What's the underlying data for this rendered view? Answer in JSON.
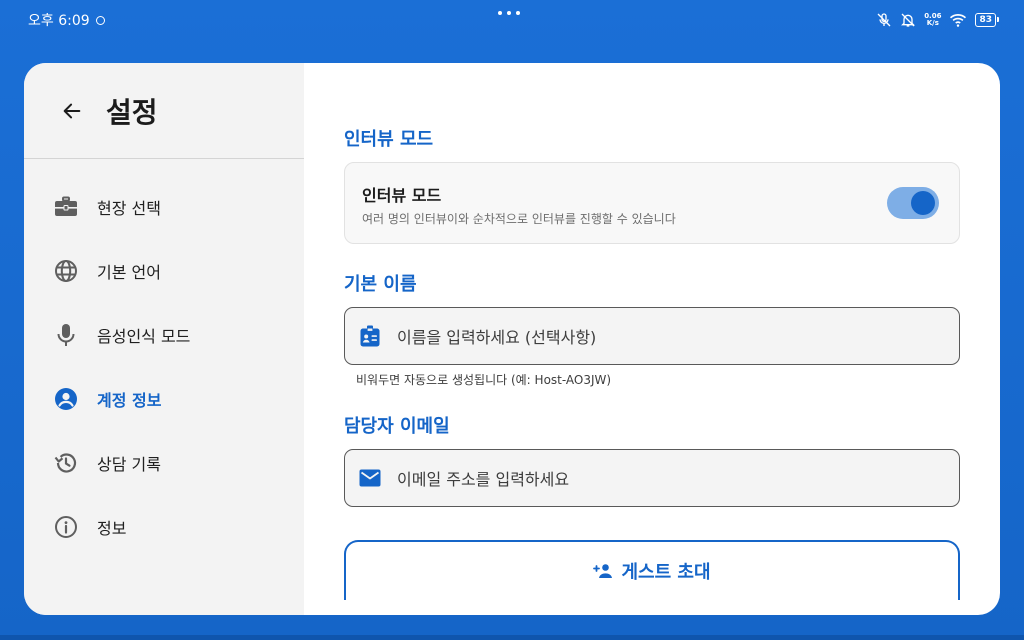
{
  "status_bar": {
    "time": "오후 6:09",
    "net_speed_value": "0.06",
    "net_speed_unit": "K/s",
    "battery": "83"
  },
  "sidebar": {
    "title": "설정",
    "items": [
      {
        "label": "현장 선택",
        "icon": "briefcase-icon"
      },
      {
        "label": "기본 언어",
        "icon": "globe-icon"
      },
      {
        "label": "음성인식 모드",
        "icon": "microphone-icon"
      },
      {
        "label": "계정 정보",
        "icon": "account-circle-icon",
        "active": true
      },
      {
        "label": "상담 기록",
        "icon": "history-icon"
      },
      {
        "label": "정보",
        "icon": "info-icon"
      }
    ]
  },
  "main": {
    "interview_section": {
      "title": "인터뷰 모드",
      "toggle_title": "인터뷰 모드",
      "toggle_description": "여러 명의 인터뷰이와 순차적으로 인터뷰를 진행할 수 있습니다",
      "toggle_on": true
    },
    "name_section": {
      "title": "기본 이름",
      "placeholder": "이름을 입력하세요 (선택사항)",
      "helper": "비워두면 자동으로 생성됩니다 (예: Host-AO3JW)"
    },
    "email_section": {
      "title": "담당자 이메일",
      "placeholder": "이메일 주소를 입력하세요"
    },
    "invite_button_label": "게스트 초대"
  },
  "colors": {
    "accent": "#1565c8",
    "background": "#1b6fd6",
    "sidebar_bg": "#f3f3f3"
  }
}
